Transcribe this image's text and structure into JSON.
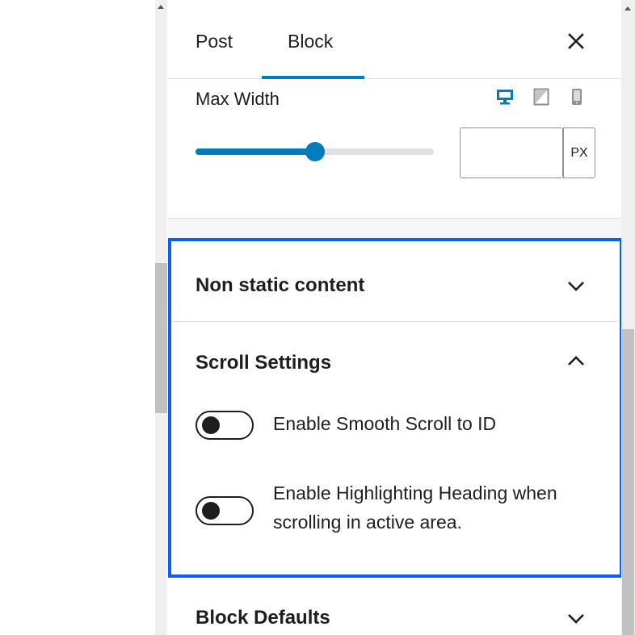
{
  "tabs": {
    "post_label": "Post",
    "block_label": "Block",
    "active": "Block"
  },
  "max_width": {
    "label": "Max Width",
    "device_icons": [
      "desktop-icon",
      "tablet-icon",
      "mobile-icon"
    ],
    "active_device": "desktop",
    "slider_fraction": 0.5,
    "input_value": "",
    "unit": "PX"
  },
  "sections": {
    "non_static": {
      "title": "Non static content",
      "expanded": false
    },
    "scroll_settings": {
      "title": "Scroll Settings",
      "expanded": true,
      "toggles": [
        {
          "label": "Enable Smooth Scroll to ID",
          "checked": false
        },
        {
          "label": "Enable Highlighting Heading when scrolling in active area.",
          "checked": false
        }
      ]
    },
    "block_defaults": {
      "title": "Block Defaults",
      "expanded": false
    }
  },
  "colors": {
    "accent": "#007cba",
    "highlight_border": "#0a5ff0",
    "text": "#1e1e1e"
  }
}
